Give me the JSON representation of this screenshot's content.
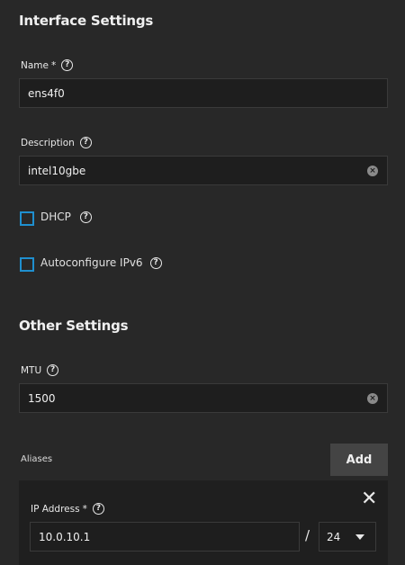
{
  "interface_settings": {
    "title": "Interface Settings",
    "name_label": "Name",
    "required_mark": "*",
    "name_value": "ens4f0",
    "description_label": "Description",
    "description_value": "intel10gbe",
    "dhcp_label": "DHCP",
    "ipv6_label": "Autoconfigure IPv6",
    "help_glyph": "?",
    "clear_glyph": "×"
  },
  "other_settings": {
    "title": "Other Settings",
    "mtu_label": "MTU",
    "mtu_value": "1500"
  },
  "aliases": {
    "label": "Aliases",
    "add_label": "Add",
    "ip_label": "IP Address",
    "ip_value": "10.0.10.1",
    "slash": "/",
    "netmask_value": "24",
    "close_glyph": "✕"
  },
  "colors": {
    "background": "#282828",
    "input_bg": "#1e1e1e",
    "checkbox_accent": "#1f8fcf",
    "button_bg": "#444444"
  },
  "icons": [
    "help-circle-icon",
    "clear-icon",
    "close-icon",
    "chevron-down-icon"
  ]
}
